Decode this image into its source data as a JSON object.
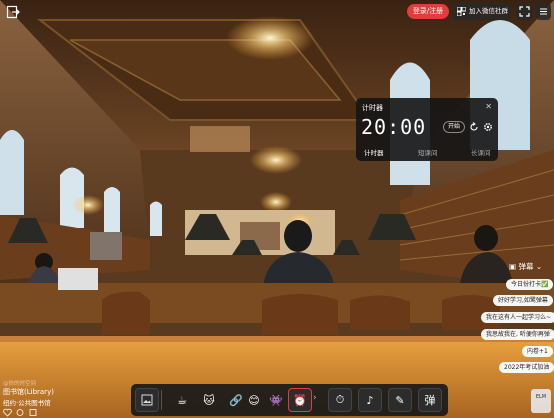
{
  "topbar": {
    "login_label": "登录/注册",
    "group_label": "加入微信社群"
  },
  "timer": {
    "title": "计时器",
    "time": "20:00",
    "start_label": "开始",
    "tabs": [
      "计时器",
      "短课间",
      "长课间"
    ],
    "active_tab": 0
  },
  "danmu": {
    "header": "弹幕",
    "messages": [
      "今日份打卡✅",
      "好好学习,如鹭弹幕",
      "我在这有人一起学习么~",
      "我思故我在, 听便你再弹",
      "内卷+1",
      "2022年考试加油"
    ]
  },
  "room": {
    "subtitle": "@你的时空间",
    "name": "图书馆(Library)",
    "location": "纽约·公共图书馆"
  },
  "toolbar": {
    "items": [
      {
        "name": "wallpaper-icon",
        "glyph": "▣"
      },
      {
        "name": "coffee-icon",
        "glyph": "☕"
      },
      {
        "name": "cat-icon",
        "glyph": "🐱"
      },
      {
        "name": "chain-icon",
        "glyph": "🔗"
      },
      {
        "name": "face-icon",
        "glyph": "😊"
      },
      {
        "name": "mascot-icon",
        "glyph": "👾"
      },
      {
        "name": "alarm-icon",
        "glyph": "⏰"
      },
      {
        "name": "timer-icon",
        "glyph": "⏱"
      },
      {
        "name": "music-icon",
        "glyph": "♪"
      },
      {
        "name": "edit-icon",
        "glyph": "✎"
      },
      {
        "name": "danmu-icon",
        "glyph": "弹"
      }
    ],
    "corner_label": "ELM"
  },
  "colors": {
    "accent_red": "#e23c3c",
    "lamp_glow": "#ffe4a0",
    "panel_dark": "#141414"
  }
}
